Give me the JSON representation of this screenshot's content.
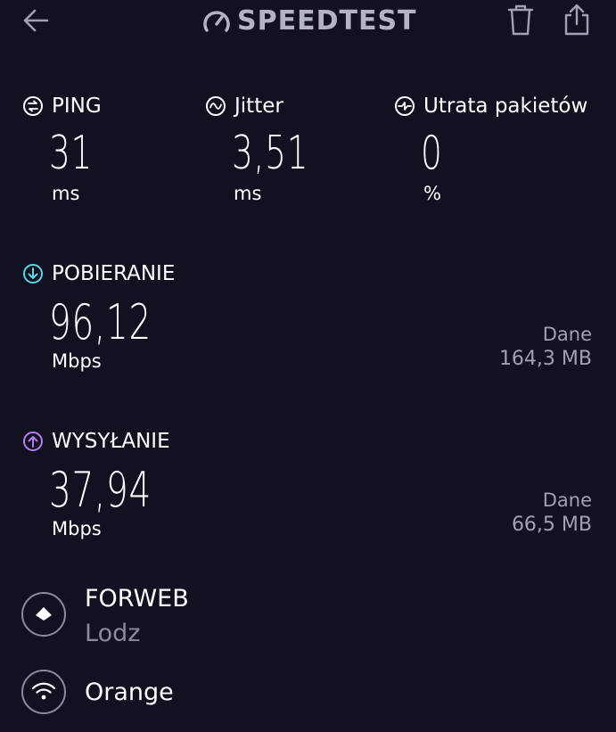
{
  "header": {
    "logo_text": "SPEEDTEST",
    "icons": {
      "back": "arrow-left-icon",
      "delete": "trash-icon",
      "share": "share-icon",
      "logo": "speedometer-icon"
    }
  },
  "ping": {
    "label": "PING",
    "value": "31",
    "unit": "ms",
    "icon": "ping-icon"
  },
  "jitter": {
    "label": "Jitter",
    "value": "3,51",
    "unit": "ms",
    "icon": "jitter-icon"
  },
  "packet_loss": {
    "label": "Utrata pakietów",
    "value": "0",
    "unit": "%",
    "icon": "packet-loss-icon"
  },
  "download": {
    "label": "POBIERANIE",
    "value": "96,12",
    "unit": "Mbps",
    "data_label": "Dane",
    "data_value": "164,3 MB",
    "icon": "download-icon",
    "color": "#5fd3e0"
  },
  "upload": {
    "label": "WYSYŁANIE",
    "value": "37,94",
    "unit": "Mbps",
    "data_label": "Dane",
    "data_value": "66,5 MB",
    "icon": "upload-icon",
    "color": "#b67cf0"
  },
  "server": {
    "name": "FORWEB",
    "location": "Lodz",
    "icon": "server-icon"
  },
  "network": {
    "name": "Orange",
    "icon": "wifi-icon"
  }
}
